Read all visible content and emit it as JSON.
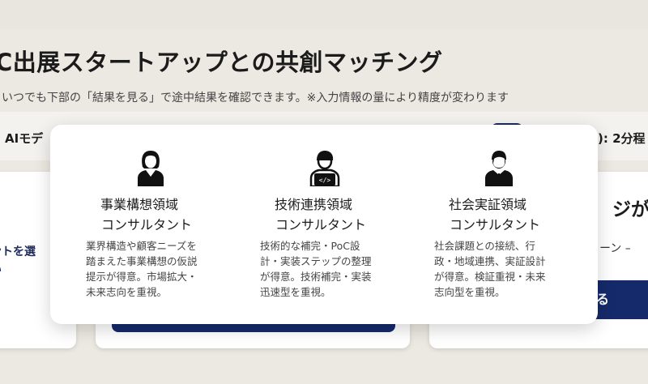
{
  "header": {
    "title": "C出展スタートアップとの共創マッチング",
    "subtitle": "いつでも下部の「結果を見る」で途中結果を確認できます。※入力情報の量により精度が変わります"
  },
  "model_bar": {
    "label": "AIモデ",
    "time_text": "): 2分程"
  },
  "cards": {
    "left_text": [
      "ントを選",
      "い"
    ],
    "right_heading": "ジが未",
    "right_subtext": "ーン –",
    "right_button": "る"
  },
  "popup": {
    "columns": [
      {
        "icon": "businesswoman-icon",
        "title_line1": "事業構想領域",
        "title_line2": "コンサルタント",
        "desc": [
          "業界構造や顧客ニーズを",
          "踏まえた事業構想の仮説",
          "提示が得意。市場拡大・",
          "未来志向を重視。"
        ]
      },
      {
        "icon": "engineer-laptop-icon",
        "title_line1": "技術連携領域",
        "title_line2": "コンサルタント",
        "desc": [
          "技術的な補完・PoC設",
          "計・実装ステップの整理",
          "が得意。技術補完・実装",
          "迅速型を重視。"
        ]
      },
      {
        "icon": "businessman-icon",
        "title_line1": "社会実証領域",
        "title_line2": "コンサルタント",
        "desc": [
          "社会課題との接続、行",
          "政・地域連携、実証設計",
          "が得意。検証重視・未来",
          "志向型を重視。"
        ]
      }
    ]
  },
  "colors": {
    "background": "#ece8e2",
    "navy": "#152a6b",
    "panel": "#ffffff"
  }
}
